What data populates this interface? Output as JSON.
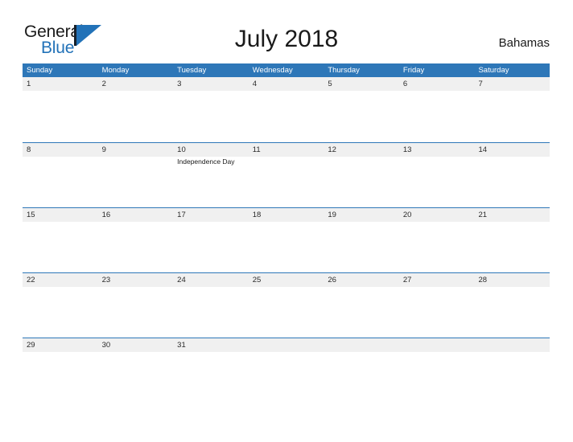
{
  "brand": {
    "name_part1": "General",
    "name_part2": "Blue",
    "logo_icon": "triangle-flag-logo",
    "primary_color": "#2272b8"
  },
  "header": {
    "title": "July 2018",
    "country": "Bahamas"
  },
  "calendar": {
    "accent_color": "#2e77b8",
    "band_color": "#f0f0f0",
    "weekdays": [
      "Sunday",
      "Monday",
      "Tuesday",
      "Wednesday",
      "Thursday",
      "Friday",
      "Saturday"
    ],
    "weeks": [
      {
        "days": [
          {
            "number": "1",
            "events": []
          },
          {
            "number": "2",
            "events": []
          },
          {
            "number": "3",
            "events": []
          },
          {
            "number": "4",
            "events": []
          },
          {
            "number": "5",
            "events": []
          },
          {
            "number": "6",
            "events": []
          },
          {
            "number": "7",
            "events": []
          }
        ]
      },
      {
        "days": [
          {
            "number": "8",
            "events": []
          },
          {
            "number": "9",
            "events": []
          },
          {
            "number": "10",
            "events": [
              "Independence Day"
            ]
          },
          {
            "number": "11",
            "events": []
          },
          {
            "number": "12",
            "events": []
          },
          {
            "number": "13",
            "events": []
          },
          {
            "number": "14",
            "events": []
          }
        ]
      },
      {
        "days": [
          {
            "number": "15",
            "events": []
          },
          {
            "number": "16",
            "events": []
          },
          {
            "number": "17",
            "events": []
          },
          {
            "number": "18",
            "events": []
          },
          {
            "number": "19",
            "events": []
          },
          {
            "number": "20",
            "events": []
          },
          {
            "number": "21",
            "events": []
          }
        ]
      },
      {
        "days": [
          {
            "number": "22",
            "events": []
          },
          {
            "number": "23",
            "events": []
          },
          {
            "number": "24",
            "events": []
          },
          {
            "number": "25",
            "events": []
          },
          {
            "number": "26",
            "events": []
          },
          {
            "number": "27",
            "events": []
          },
          {
            "number": "28",
            "events": []
          }
        ]
      },
      {
        "days": [
          {
            "number": "29",
            "events": []
          },
          {
            "number": "30",
            "events": []
          },
          {
            "number": "31",
            "events": []
          },
          {
            "number": "",
            "events": []
          },
          {
            "number": "",
            "events": []
          },
          {
            "number": "",
            "events": []
          },
          {
            "number": "",
            "events": []
          }
        ]
      }
    ]
  }
}
